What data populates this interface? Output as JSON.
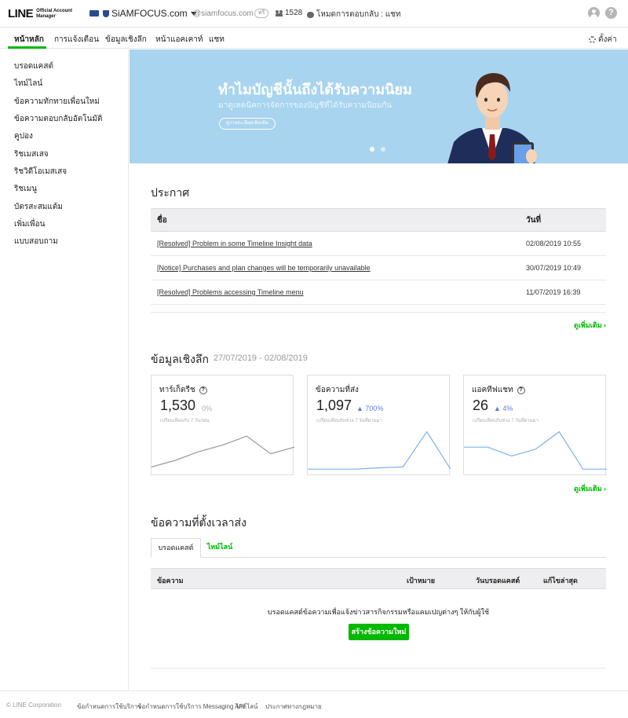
{
  "header": {
    "logo_main": "LINE",
    "logo_sub_line1": "Official Account",
    "logo_sub_line2": "Manager",
    "account_name": "SiAMFOCUS.com",
    "account_id": "@siamfocus.com",
    "plan_badge": "ฟรี",
    "friend_count": "1528",
    "response_mode": "โหมดการตอบกลับ : แชท"
  },
  "nav": {
    "tabs": [
      "หน้าหลัก",
      "การแจ้งเตือน",
      "ข้อมูลเชิงลึก",
      "หน้าแอคเคาท์",
      "แชท"
    ],
    "settings_label": "ตั้งค่า"
  },
  "sidebar": {
    "items": [
      "บรอดแคสต์",
      "ไทม์ไลน์",
      "ข้อความทักทายเพื่อนใหม่",
      "ข้อความตอบกลับอัตโนมัติ",
      "คูปอง",
      "ริชเมสเสจ",
      "ริชวิดีโอเมสเสจ",
      "ริชเมนู",
      "บัตรสะสมแต้ม",
      "เพิ่มเพื่อน",
      "แบบสอบถาม"
    ]
  },
  "banner": {
    "title": "ทำไมบัญชีนั้นถึงได้รับความนิยม",
    "subtitle": "มาดูเทคนิคการจัดการของบัญชีที่ได้รับความนิยมกัน",
    "button_label": "ดูรายละเอียดเพิ่มเติม",
    "colors": {
      "background": "#a8d4ef",
      "active_dot": "#ffffff"
    }
  },
  "announcements": {
    "heading": "ประกาศ",
    "columns": [
      "ชื่อ",
      "วันที่"
    ],
    "rows": [
      {
        "title": "[Resolved] Problem in some Timeline Insight data",
        "date": "02/08/2019 10:55"
      },
      {
        "title": "[Notice] Purchases and plan changes will be temporarily unavailable",
        "date": "30/07/2019 10:49"
      },
      {
        "title": "[Resolved] Problems accessing Timeline menu",
        "date": "11/07/2019 16:39"
      }
    ],
    "more_label": "ดูเพิ่มเติม"
  },
  "insights": {
    "heading": "ข้อมูลเชิงลึก",
    "date_range": "27/07/2019 - 02/08/2019",
    "more_label": "ดูเพิ่มเติม",
    "cards": [
      {
        "title": "ทาร์เก็ตรีช",
        "value": "1,530",
        "change": "0%",
        "note": "เปรียบเทียบกับ 7 วันก่อน",
        "trend": [
          0.1,
          0.25,
          0.45,
          0.6,
          0.8,
          0.4,
          0.55
        ]
      },
      {
        "title": "ข้อความที่ส่ง",
        "value": "1,097",
        "change": "700%",
        "note": "เปรียบเทียบกับช่วง 7 วันที่ผ่านมา",
        "trend": [
          0.05,
          0.05,
          0.05,
          0.08,
          0.1,
          0.9,
          0.05
        ]
      },
      {
        "title": "แอคทีฟแชท",
        "value": "26",
        "change": "4%",
        "note": "เปรียบเทียบกับช่วง 7 วันที่ผ่านมา",
        "trend": [
          0.55,
          0.55,
          0.35,
          0.5,
          0.9,
          0.05,
          0.05
        ]
      }
    ],
    "colors": {
      "reach_line": "#9a9a9a",
      "other_line": "#7ab0ec",
      "change_up": "#5b7fe0"
    }
  },
  "scheduled": {
    "heading": "ข้อความที่ตั้งเวลาส่ง",
    "tabs": [
      "บรอดแคสต์",
      "ไทม์ไลน์"
    ],
    "columns": [
      "ข้อความ",
      "เป้าหมาย",
      "วันบรอดแคสต์",
      "แก้ไขล่าสุด"
    ],
    "empty_message": "บรอดแคสต์ข้อความเพื่อแจ้งข่าวสารกิจกรรมหรือแคมเปญต่างๆ ให้กับผู้ใช้",
    "create_button": "สร้างข้อความใหม่"
  },
  "footer": {
    "copyright": "© LINE Corporation",
    "links": [
      "ข้อกำหนดการใช้บริการ",
      "ข้อกำหนดการใช้บริการ Messaging API",
      "ไกด์ไลน์",
      "ประกาศทางกฎหมาย"
    ]
  }
}
